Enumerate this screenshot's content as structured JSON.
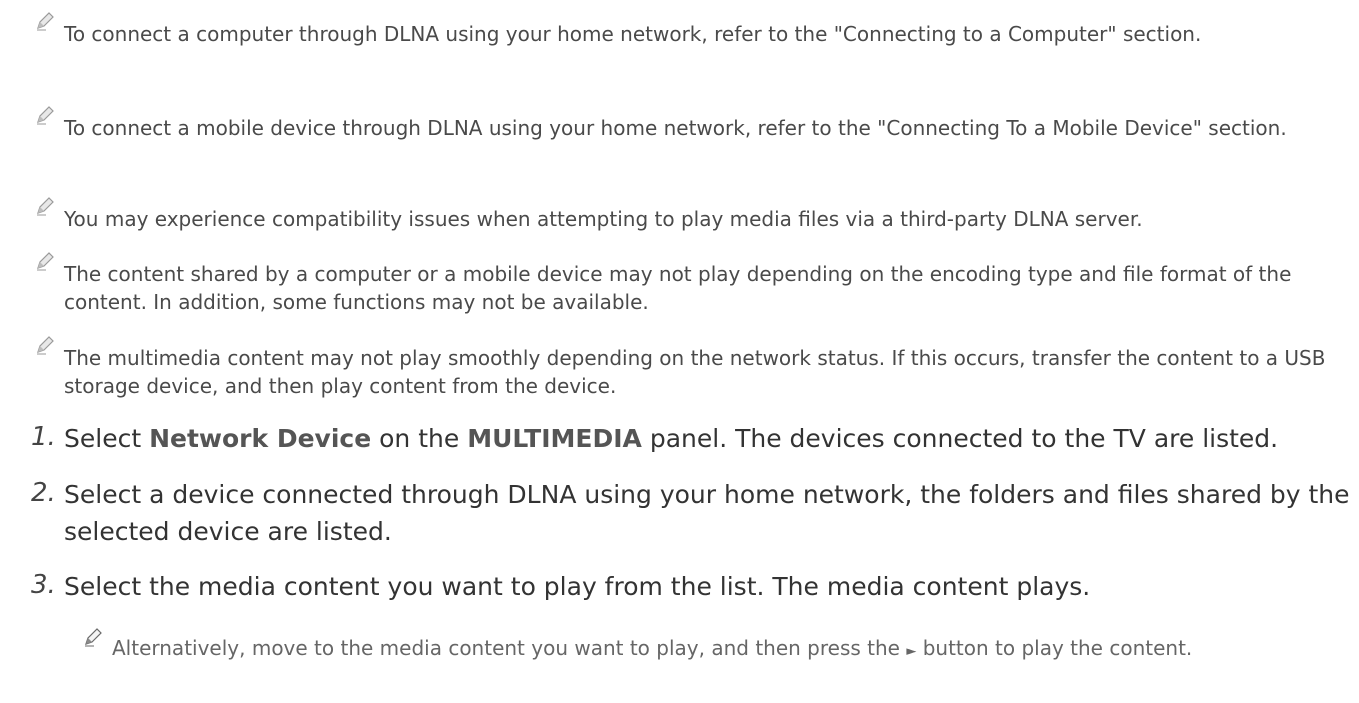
{
  "notes": [
    "To connect a computer through DLNA using your home network, refer to the \"Connecting to a Computer\" section.",
    "To connect a mobile device through DLNA using your home network, refer to the \"Connecting To a Mobile Device\" section.",
    "You may experience compatibility issues when attempting to play media files via a third-party DLNA server.",
    "The content shared by a computer or a mobile device may not play depending on the encoding type and file format of the content. In addition, some functions may not be available.",
    "The multimedia content may not play smoothly depending on the network status. If this occurs, transfer the content to a USB storage device, and then play content from the device."
  ],
  "steps": [
    {
      "number": "1.",
      "pre": "Select ",
      "bold1": "Network Device",
      "mid": " on the ",
      "bold2": "MULTIMEDIA",
      "post": " panel. The devices connected to the TV are listed."
    },
    {
      "number": "2.",
      "text": "Select a device connected through DLNA using your home network, the folders and files shared by the selected device are listed."
    },
    {
      "number": "3.",
      "text": "Select the media content you want to play from the list. The media content plays."
    }
  ],
  "sub_note": {
    "pre": "Alternatively, move to the media content you want to play, and then press the ",
    "symbol": "►",
    "post": " button to play the content."
  },
  "icon": "pencil-note-icon"
}
